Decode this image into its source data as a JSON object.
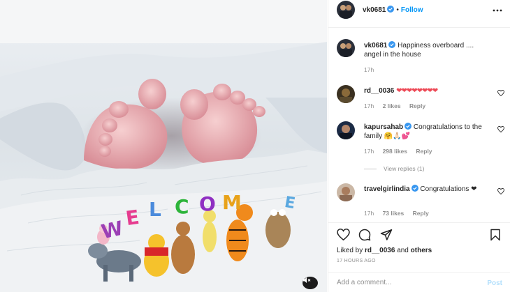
{
  "post": {
    "author": "vk0681",
    "follow_label": "Follow",
    "dot": "•",
    "caption": "Happiness overboard .... angel in the house",
    "caption_time": "17h"
  },
  "media": {
    "banner_letters": [
      "W",
      "E",
      "L",
      "C",
      "O",
      "M",
      "E"
    ],
    "banner_colors": [
      "#9b3fb5",
      "#e63c8f",
      "#4b8bdc",
      "#2db43a",
      "#8f2fc2",
      "#e8a21a",
      "#5aa8e0"
    ],
    "mute_icon": "speaker-muted-icon"
  },
  "comments": [
    {
      "user": "rd__0036",
      "verified": false,
      "text": "❤❤❤❤❤❤❤❤",
      "time": "17h",
      "likes": "2 likes",
      "reply": "Reply"
    },
    {
      "user": "kapursahab",
      "verified": true,
      "text": "Congratulations to the family 🤗🙏🏻💕",
      "time": "17h",
      "likes": "298 likes",
      "reply": "Reply",
      "view_replies": "View replies (1)"
    },
    {
      "user": "travelgirlindia",
      "verified": true,
      "text": "Congratulations ❤",
      "time": "17h",
      "likes": "73 likes",
      "reply": "Reply"
    }
  ],
  "actions": {
    "liked_prefix": "Liked by",
    "liked_user": "rd__0036",
    "liked_and": "and",
    "liked_others": "others",
    "timestamp": "17 HOURS AGO"
  },
  "add_comment": {
    "placeholder": "Add a comment...",
    "post_label": "Post"
  },
  "colors": {
    "accent": "#0095f6",
    "heart": "#ed4956",
    "muted_text": "#8e8e8e"
  }
}
